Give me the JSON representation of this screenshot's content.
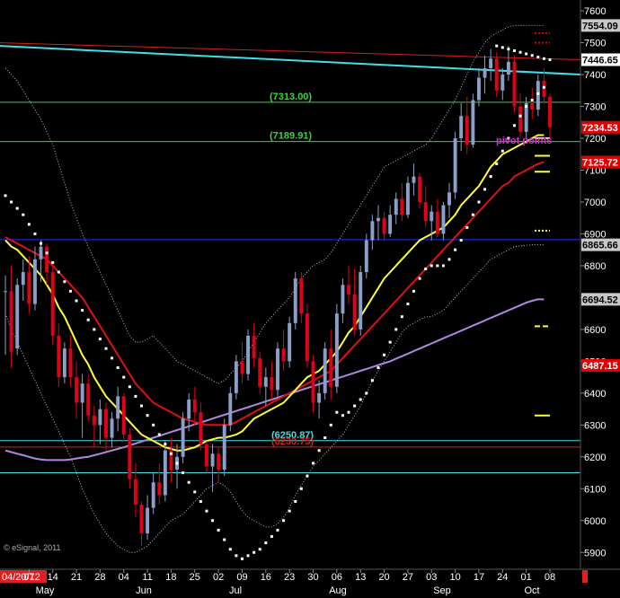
{
  "chart_data": {
    "type": "candlestick",
    "watermark": "© eSignal, 2011",
    "colors": {
      "background": "#000000",
      "up_candle": "#8aa0c8",
      "down_candle": "#e0001a",
      "sma_yellow": "#ffff33",
      "sma_red": "#e01010",
      "sma_purple": "#b088e0",
      "bollinger": "#bbbbbb",
      "psar": "#ffffff",
      "trendline_cyan": "#40e0e8",
      "fib_green": "#40d040",
      "blue_line": "#2030ff",
      "resistance_red": "#d02020",
      "pivot_magenta": "#d030d0",
      "axis_text": "#ffffff",
      "date_highlight_bg": "#e02020"
    },
    "y_axis": {
      "min": 5850,
      "max": 7620,
      "ticks": [
        5900,
        6000,
        6100,
        6200,
        6300,
        6400,
        6500,
        6600,
        6700,
        6800,
        6900,
        7000,
        7100,
        7200,
        7300,
        7400,
        7500,
        7600
      ]
    },
    "x_axis": {
      "day_labels": [
        "04/20/12",
        "07",
        "14",
        "21",
        "28",
        "04",
        "11",
        "18",
        "25",
        "02",
        "09",
        "16",
        "23",
        "30",
        "06",
        "13",
        "20",
        "27",
        "03",
        "10",
        "17",
        "24",
        "01",
        "08"
      ],
      "month_labels": [
        "May",
        "Jun",
        "Jul",
        "Aug",
        "Sep",
        "Oct"
      ]
    },
    "price_tags": [
      {
        "label": "7554.09",
        "value": 7554.09,
        "bg": "#c8c8c8",
        "fg": "#000000"
      },
      {
        "label": "7446.65",
        "value": 7446.65,
        "bg": "#ffffff",
        "fg": "#000000"
      },
      {
        "label": "7234.53",
        "value": 7234.53,
        "bg": "#e00000",
        "fg": "#ffffff"
      },
      {
        "label": "7125.72",
        "value": 7125.72,
        "bg": "#e00000",
        "fg": "#ffffff"
      },
      {
        "label": "6865.66",
        "value": 6865.66,
        "bg": "#c8c8c8",
        "fg": "#000000"
      },
      {
        "label": "6694.52",
        "value": 6694.52,
        "bg": "#c8c8c8",
        "fg": "#000000"
      },
      {
        "label": "6487.15",
        "value": 6487.15,
        "bg": "#e00000",
        "fg": "#ffffff"
      }
    ],
    "horizontal_levels": [
      {
        "label": "(7313.00)",
        "value": 7313.0,
        "color": "#40d040"
      },
      {
        "label": "(7189.91)",
        "value": 7189.91,
        "color": "#40d040"
      },
      {
        "label": "",
        "value": 6882.0,
        "color": "#2030ff"
      },
      {
        "label": "(6250.87)",
        "value": 6250.87,
        "color": "#40e0e8"
      },
      {
        "label": "(6230.75)",
        "value": 6230.75,
        "color": "#d02020"
      },
      {
        "label": "",
        "value": 6150.0,
        "color": "#40e0e8"
      }
    ],
    "annotations": [
      {
        "text": "pivot",
        "value": 7195.0,
        "color": "#d030d0"
      },
      {
        "text": "points",
        "value": 7195.0,
        "color": "#d030d0"
      }
    ],
    "pivot_markers": [
      {
        "value": 7530,
        "style": "dotted",
        "color": "#e00000"
      },
      {
        "value": 7500,
        "style": "dotted",
        "color": "#e00000"
      },
      {
        "value": 7200,
        "style": "solid",
        "color": "#ffff33"
      },
      {
        "value": 7145,
        "style": "solid",
        "color": "#ffff33"
      },
      {
        "value": 7095,
        "style": "solid",
        "color": "#ffff33"
      },
      {
        "value": 6910,
        "style": "dotted",
        "color": "#ffff33"
      },
      {
        "value": 6610,
        "style": "dashed",
        "color": "#ffff33"
      },
      {
        "value": 6330,
        "style": "solid",
        "color": "#ffff33"
      }
    ],
    "candles": [
      {
        "o": 6720,
        "h": 6770,
        "l": 6520,
        "c": 6720
      },
      {
        "o": 6720,
        "h": 6800,
        "l": 6480,
        "c": 6530
      },
      {
        "o": 6540,
        "h": 6760,
        "l": 6520,
        "c": 6740
      },
      {
        "o": 6740,
        "h": 6820,
        "l": 6690,
        "c": 6780
      },
      {
        "o": 6780,
        "h": 6830,
        "l": 6650,
        "c": 6680
      },
      {
        "o": 6680,
        "h": 6860,
        "l": 6660,
        "c": 6820
      },
      {
        "o": 6820,
        "h": 6880,
        "l": 6750,
        "c": 6860
      },
      {
        "o": 6860,
        "h": 6870,
        "l": 6740,
        "c": 6780
      },
      {
        "o": 6780,
        "h": 6800,
        "l": 6550,
        "c": 6580
      },
      {
        "o": 6580,
        "h": 6620,
        "l": 6420,
        "c": 6450
      },
      {
        "o": 6450,
        "h": 6560,
        "l": 6430,
        "c": 6540
      },
      {
        "o": 6540,
        "h": 6580,
        "l": 6420,
        "c": 6450
      },
      {
        "o": 6450,
        "h": 6500,
        "l": 6320,
        "c": 6370
      },
      {
        "o": 6370,
        "h": 6460,
        "l": 6260,
        "c": 6430
      },
      {
        "o": 6430,
        "h": 6460,
        "l": 6310,
        "c": 6330
      },
      {
        "o": 6330,
        "h": 6360,
        "l": 6230,
        "c": 6300
      },
      {
        "o": 6300,
        "h": 6380,
        "l": 6240,
        "c": 6350
      },
      {
        "o": 6350,
        "h": 6370,
        "l": 6220,
        "c": 6260
      },
      {
        "o": 6260,
        "h": 6340,
        "l": 6230,
        "c": 6320
      },
      {
        "o": 6320,
        "h": 6420,
        "l": 6280,
        "c": 6390
      },
      {
        "o": 6390,
        "h": 6400,
        "l": 6250,
        "c": 6270
      },
      {
        "o": 6270,
        "h": 6290,
        "l": 6100,
        "c": 6130
      },
      {
        "o": 6130,
        "h": 6180,
        "l": 6010,
        "c": 6050
      },
      {
        "o": 6050,
        "h": 6060,
        "l": 5920,
        "c": 5960
      },
      {
        "o": 5960,
        "h": 6080,
        "l": 5940,
        "c": 6040
      },
      {
        "o": 6040,
        "h": 6150,
        "l": 6020,
        "c": 6120
      },
      {
        "o": 6120,
        "h": 6180,
        "l": 6050,
        "c": 6080
      },
      {
        "o": 6080,
        "h": 6250,
        "l": 6060,
        "c": 6220
      },
      {
        "o": 6220,
        "h": 6260,
        "l": 6120,
        "c": 6160
      },
      {
        "o": 6160,
        "h": 6240,
        "l": 6100,
        "c": 6200
      },
      {
        "o": 6200,
        "h": 6340,
        "l": 6180,
        "c": 6320
      },
      {
        "o": 6320,
        "h": 6400,
        "l": 6280,
        "c": 6380
      },
      {
        "o": 6380,
        "h": 6420,
        "l": 6300,
        "c": 6340
      },
      {
        "o": 6340,
        "h": 6370,
        "l": 6220,
        "c": 6240
      },
      {
        "o": 6240,
        "h": 6250,
        "l": 6150,
        "c": 6170
      },
      {
        "o": 6170,
        "h": 6240,
        "l": 6090,
        "c": 6210
      },
      {
        "o": 6210,
        "h": 6230,
        "l": 6120,
        "c": 6160
      },
      {
        "o": 6160,
        "h": 6320,
        "l": 6140,
        "c": 6300
      },
      {
        "o": 6300,
        "h": 6420,
        "l": 6280,
        "c": 6400
      },
      {
        "o": 6400,
        "h": 6520,
        "l": 6380,
        "c": 6500
      },
      {
        "o": 6500,
        "h": 6560,
        "l": 6430,
        "c": 6460
      },
      {
        "o": 6460,
        "h": 6600,
        "l": 6440,
        "c": 6580
      },
      {
        "o": 6580,
        "h": 6620,
        "l": 6480,
        "c": 6510
      },
      {
        "o": 6510,
        "h": 6530,
        "l": 6400,
        "c": 6420
      },
      {
        "o": 6420,
        "h": 6480,
        "l": 6360,
        "c": 6450
      },
      {
        "o": 6450,
        "h": 6500,
        "l": 6380,
        "c": 6410
      },
      {
        "o": 6410,
        "h": 6560,
        "l": 6390,
        "c": 6540
      },
      {
        "o": 6540,
        "h": 6600,
        "l": 6470,
        "c": 6500
      },
      {
        "o": 6500,
        "h": 6640,
        "l": 6480,
        "c": 6620
      },
      {
        "o": 6620,
        "h": 6780,
        "l": 6600,
        "c": 6760
      },
      {
        "o": 6760,
        "h": 6780,
        "l": 6620,
        "c": 6650
      },
      {
        "o": 6650,
        "h": 6680,
        "l": 6480,
        "c": 6500
      },
      {
        "o": 6500,
        "h": 6520,
        "l": 6340,
        "c": 6370
      },
      {
        "o": 6370,
        "h": 6440,
        "l": 6320,
        "c": 6400
      },
      {
        "o": 6400,
        "h": 6560,
        "l": 6380,
        "c": 6540
      },
      {
        "o": 6540,
        "h": 6600,
        "l": 6380,
        "c": 6420
      },
      {
        "o": 6420,
        "h": 6680,
        "l": 6400,
        "c": 6650
      },
      {
        "o": 6650,
        "h": 6760,
        "l": 6620,
        "c": 6740
      },
      {
        "o": 6740,
        "h": 6800,
        "l": 6680,
        "c": 6710
      },
      {
        "o": 6710,
        "h": 6790,
        "l": 6580,
        "c": 6600
      },
      {
        "o": 6600,
        "h": 6800,
        "l": 6580,
        "c": 6780
      },
      {
        "o": 6780,
        "h": 6900,
        "l": 6760,
        "c": 6880
      },
      {
        "o": 6880,
        "h": 6960,
        "l": 6850,
        "c": 6940
      },
      {
        "o": 6940,
        "h": 6990,
        "l": 6880,
        "c": 6950
      },
      {
        "o": 6950,
        "h": 6970,
        "l": 6880,
        "c": 6900
      },
      {
        "o": 6900,
        "h": 6990,
        "l": 6890,
        "c": 6960
      },
      {
        "o": 6960,
        "h": 7030,
        "l": 6930,
        "c": 7010
      },
      {
        "o": 7010,
        "h": 7060,
        "l": 6940,
        "c": 6960
      },
      {
        "o": 6960,
        "h": 7080,
        "l": 6950,
        "c": 7060
      },
      {
        "o": 7060,
        "h": 7120,
        "l": 7020,
        "c": 7080
      },
      {
        "o": 7080,
        "h": 7090,
        "l": 6980,
        "c": 7000
      },
      {
        "o": 7000,
        "h": 7050,
        "l": 6920,
        "c": 6940
      },
      {
        "o": 6940,
        "h": 6990,
        "l": 6880,
        "c": 6970
      },
      {
        "o": 6970,
        "h": 7010,
        "l": 6890,
        "c": 6900
      },
      {
        "o": 6900,
        "h": 7000,
        "l": 6880,
        "c": 6990
      },
      {
        "o": 6990,
        "h": 7060,
        "l": 6950,
        "c": 7030
      },
      {
        "o": 7030,
        "h": 7220,
        "l": 7010,
        "c": 7200
      },
      {
        "o": 7200,
        "h": 7310,
        "l": 7160,
        "c": 7270
      },
      {
        "o": 7270,
        "h": 7330,
        "l": 7150,
        "c": 7180
      },
      {
        "o": 7180,
        "h": 7340,
        "l": 7170,
        "c": 7320
      },
      {
        "o": 7320,
        "h": 7420,
        "l": 7300,
        "c": 7390
      },
      {
        "o": 7390,
        "h": 7460,
        "l": 7340,
        "c": 7420
      },
      {
        "o": 7420,
        "h": 7480,
        "l": 7380,
        "c": 7450
      },
      {
        "o": 7450,
        "h": 7470,
        "l": 7330,
        "c": 7350
      },
      {
        "o": 7350,
        "h": 7420,
        "l": 7320,
        "c": 7400
      },
      {
        "o": 7400,
        "h": 7490,
        "l": 7380,
        "c": 7440
      },
      {
        "o": 7440,
        "h": 7460,
        "l": 7280,
        "c": 7300
      },
      {
        "o": 7300,
        "h": 7340,
        "l": 7200,
        "c": 7220
      },
      {
        "o": 7220,
        "h": 7330,
        "l": 7200,
        "c": 7310
      },
      {
        "o": 7310,
        "h": 7360,
        "l": 7260,
        "c": 7290
      },
      {
        "o": 7290,
        "h": 7400,
        "l": 7270,
        "c": 7380
      },
      {
        "o": 7380,
        "h": 7420,
        "l": 7310,
        "c": 7330
      },
      {
        "o": 7330,
        "h": 7340,
        "l": 7200,
        "c": 7234.53
      }
    ],
    "sma_yellow": [
      6880,
      6860,
      6850,
      6830,
      6810,
      6790,
      6770,
      6740,
      6710,
      6670,
      6640,
      6600,
      6560,
      6520,
      6490,
      6450,
      6420,
      6390,
      6370,
      6350,
      6330,
      6310,
      6290,
      6270,
      6260,
      6250,
      6240,
      6230,
      6225,
      6220,
      6220,
      6225,
      6230,
      6240,
      6250,
      6255,
      6260,
      6260,
      6265,
      6270,
      6280,
      6300,
      6320,
      6330,
      6340,
      6350,
      6360,
      6370,
      6390,
      6410,
      6430,
      6450,
      6460,
      6470,
      6490,
      6510,
      6530,
      6560,
      6590,
      6610,
      6640,
      6670,
      6700,
      6730,
      6760,
      6780,
      6800,
      6820,
      6840,
      6860,
      6880,
      6890,
      6900,
      6910,
      6920,
      6940,
      6960,
      6990,
      7010,
      7030,
      7050,
      7080,
      7110,
      7130,
      7150,
      7160,
      7170,
      7180,
      7190,
      7200,
      7210,
      7210
    ],
    "sma_red": [
      6890,
      6880,
      6870,
      6860,
      6850,
      6840,
      6830,
      6820,
      6800,
      6780,
      6760,
      6740,
      6720,
      6700,
      6670,
      6640,
      6610,
      6580,
      6550,
      6520,
      6490,
      6460,
      6430,
      6410,
      6390,
      6370,
      6360,
      6350,
      6340,
      6330,
      6320,
      6315,
      6310,
      6305,
      6300,
      6300,
      6300,
      6300,
      6300,
      6310,
      6320,
      6330,
      6340,
      6350,
      6360,
      6370,
      6380,
      6390,
      6400,
      6410,
      6420,
      6430,
      6440,
      6450,
      6460,
      6470,
      6490,
      6510,
      6530,
      6550,
      6570,
      6590,
      6610,
      6630,
      6650,
      6670,
      6690,
      6710,
      6730,
      6750,
      6770,
      6790,
      6810,
      6830,
      6850,
      6870,
      6890,
      6910,
      6930,
      6950,
      6970,
      6990,
      7010,
      7030,
      7050,
      7060,
      7080,
      7090,
      7100,
      7110,
      7120,
      7125.72
    ],
    "sma_purple": [
      6220,
      6215,
      6210,
      6205,
      6200,
      6195,
      6192,
      6190,
      6190,
      6190,
      6190,
      6192,
      6195,
      6198,
      6200,
      6205,
      6210,
      6215,
      6220,
      6225,
      6230,
      6236,
      6242,
      6248,
      6254,
      6260,
      6266,
      6272,
      6278,
      6284,
      6290,
      6296,
      6302,
      6308,
      6314,
      6320,
      6326,
      6332,
      6338,
      6344,
      6350,
      6356,
      6362,
      6368,
      6374,
      6380,
      6386,
      6392,
      6398,
      6404,
      6410,
      6416,
      6422,
      6428,
      6434,
      6440,
      6446,
      6452,
      6458,
      6464,
      6470,
      6476,
      6482,
      6488,
      6494,
      6500,
      6508,
      6516,
      6524,
      6532,
      6540,
      6548,
      6556,
      6564,
      6572,
      6580,
      6588,
      6596,
      6604,
      6612,
      6620,
      6628,
      6636,
      6644,
      6652,
      6660,
      6668,
      6676,
      6684,
      6690,
      6694.52,
      6694.52
    ],
    "bb_upper": [
      7420,
      7400,
      7380,
      7350,
      7320,
      7290,
      7260,
      7220,
      7180,
      7120,
      7060,
      7000,
      6950,
      6900,
      6860,
      6820,
      6780,
      6740,
      6700,
      6660,
      6620,
      6580,
      6560,
      6560,
      6570,
      6580,
      6560,
      6540,
      6520,
      6500,
      6490,
      6480,
      6470,
      6460,
      6450,
      6440,
      6430,
      6440,
      6460,
      6480,
      6500,
      6530,
      6560,
      6590,
      6620,
      6640,
      6660,
      6680,
      6700,
      6730,
      6760,
      6780,
      6800,
      6810,
      6820,
      6840,
      6870,
      6900,
      6930,
      6960,
      6990,
      7020,
      7050,
      7080,
      7110,
      7120,
      7130,
      7140,
      7150,
      7160,
      7170,
      7180,
      7200,
      7230,
      7260,
      7290,
      7320,
      7360,
      7400,
      7440,
      7470,
      7500,
      7520,
      7530,
      7540,
      7550,
      7554.09,
      7554.09,
      7554.09,
      7554.09,
      7554.09,
      7554.09
    ],
    "bb_lower": [
      6650,
      6600,
      6560,
      6520,
      6480,
      6440,
      6400,
      6360,
      6320,
      6280,
      6240,
      6200,
      6150,
      6100,
      6060,
      6020,
      5990,
      5960,
      5940,
      5920,
      5910,
      5900,
      5900,
      5910,
      5920,
      5940,
      5960,
      5980,
      6000,
      6010,
      6020,
      6040,
      6060,
      6080,
      6100,
      6110,
      6120,
      6110,
      6090,
      6060,
      6030,
      6010,
      6000,
      5990,
      5980,
      5980,
      5990,
      6010,
      6040,
      6080,
      6110,
      6140,
      6170,
      6190,
      6210,
      6230,
      6250,
      6270,
      6300,
      6330,
      6360,
      6400,
      6440,
      6470,
      6500,
      6530,
      6560,
      6590,
      6610,
      6620,
      6630,
      6640,
      6640,
      6650,
      6660,
      6680,
      6700,
      6720,
      6740,
      6760,
      6780,
      6800,
      6820,
      6830,
      6840,
      6850,
      6860,
      6862,
      6864,
      6865.66,
      6865.66,
      6865.66
    ],
    "psar": [
      7020,
      7000,
      6980,
      6960,
      6930,
      6900,
      6870,
      6840,
      6810,
      6780,
      6750,
      6720,
      6690,
      6660,
      6630,
      6600,
      6570,
      6540,
      6510,
      6480,
      6450,
      6420,
      6390,
      6360,
      6330,
      6300,
      6270,
      6240,
      6210,
      6180,
      6150,
      6120,
      6090,
      6060,
      6030,
      6000,
      5970,
      5940,
      5910,
      5890,
      5880,
      5890,
      5900,
      5910,
      5930,
      5950,
      5970,
      6000,
      6030,
      6060,
      6100,
      6140,
      6180,
      6220,
      6260,
      6300,
      6340,
      6330,
      6340,
      6360,
      6380,
      6400,
      6440,
      6480,
      6520,
      6560,
      6600,
      6640,
      6680,
      6720,
      6760,
      6790,
      6800,
      6800,
      6800,
      6820,
      6850,
      6880,
      6920,
      6960,
      7000,
      7040,
      7080,
      7120,
      7160,
      7200,
      7240,
      7270,
      7300,
      7320,
      7340,
      7360
    ],
    "psar_upper_seg": [
      7490,
      7485,
      7480,
      7475,
      7470,
      7465,
      7460,
      7455,
      7450,
      7446.65
    ],
    "resistance": [
      7500,
      7446.65
    ],
    "trendline": [
      7490,
      7400
    ]
  }
}
